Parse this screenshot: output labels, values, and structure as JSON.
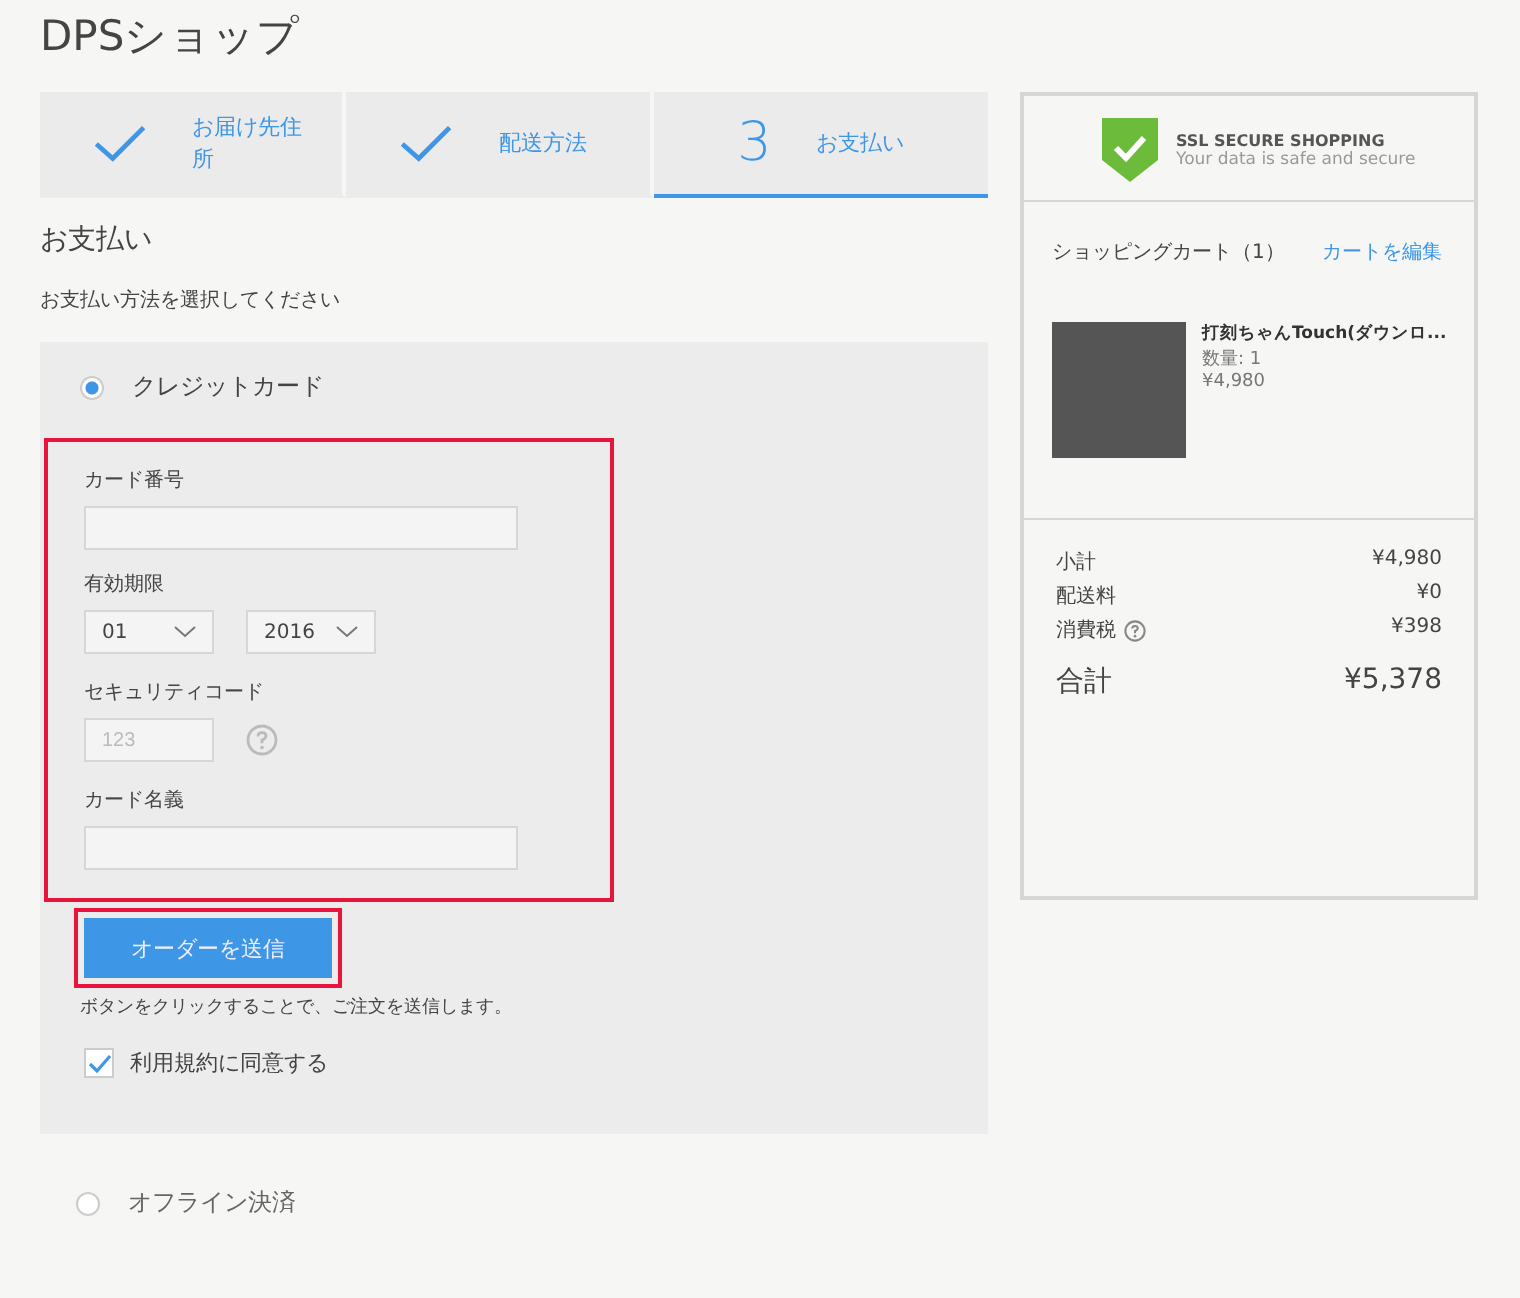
{
  "shop_title": "DPSショップ",
  "steps": [
    {
      "kind": "done",
      "label": "お届け先住所",
      "selected": false
    },
    {
      "kind": "done",
      "label": "配送方法",
      "selected": false
    },
    {
      "kind": "number",
      "number": "3",
      "label": "お支払い",
      "selected": true
    }
  ],
  "section_title": "お支払い",
  "instruction": "お支払い方法を選択してください",
  "payment_methods": [
    {
      "label": "クレジットカード",
      "selected": true
    },
    {
      "label": "オフライン決済",
      "selected": false
    }
  ],
  "card_form": {
    "card_number": {
      "label": "カード番号"
    },
    "expiry": {
      "label": "有効期限",
      "month": "01",
      "year": "2016"
    },
    "security_code": {
      "label": "セキュリティコード",
      "placeholder": "123"
    },
    "card_name": {
      "label": "カード名義"
    }
  },
  "submit_button": "オーダーを送信",
  "submit_note": "ボタンをクリックすることで、ご注文を送信します。",
  "terms": {
    "label": "利用規約に同意する",
    "checked": true
  },
  "ssl_badge": {
    "title": "SSL SECURE SHOPPING",
    "subtitle": "Your data is safe and secure"
  },
  "cart": {
    "title": "ショッピングカート（1）",
    "edit_link": "カートを編集",
    "items": [
      {
        "name": "打刻ちゃんTouch(ダウンロ...",
        "quantity": "数量: 1",
        "price": "¥4,980"
      }
    ],
    "summary": [
      {
        "label": "小計",
        "value": "¥4,980",
        "help": false
      },
      {
        "label": "配送料",
        "value": "¥0",
        "help": false
      },
      {
        "label": "消費税",
        "value": "¥398",
        "help": true
      }
    ],
    "total_label": "合計",
    "total_value": "¥5,378"
  }
}
